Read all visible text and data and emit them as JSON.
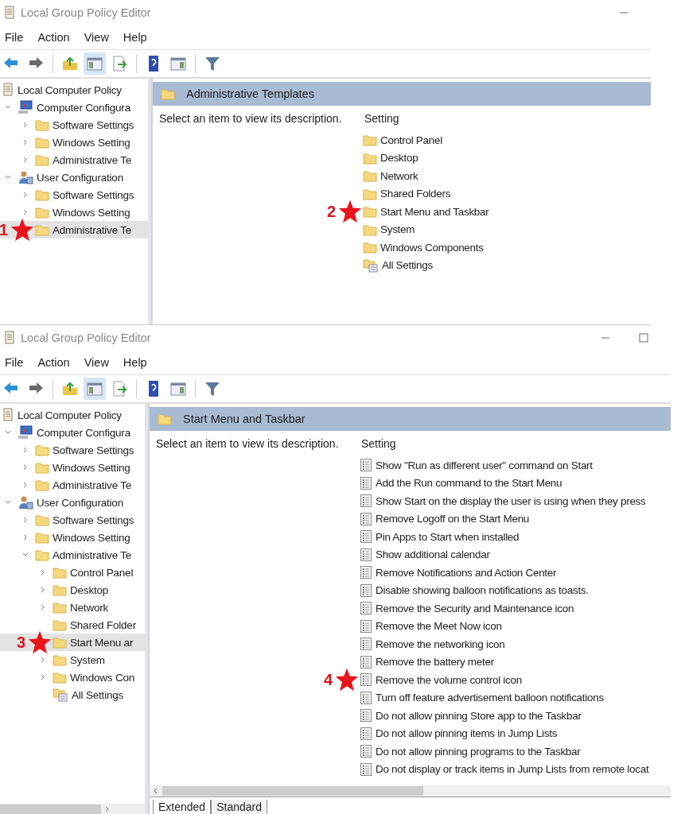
{
  "windows": [
    {
      "title": "Local Group Policy Editor",
      "menu": [
        "File",
        "Action",
        "View",
        "Help"
      ],
      "toolbar": [
        {
          "kind": "back",
          "pressed": false
        },
        {
          "kind": "forward",
          "pressed": false
        },
        {
          "kind": "separator"
        },
        {
          "kind": "up",
          "pressed": false
        },
        {
          "kind": "tree",
          "pressed": true
        },
        {
          "kind": "export",
          "pressed": false
        },
        {
          "kind": "separator"
        },
        {
          "kind": "help",
          "pressed": false
        },
        {
          "kind": "pane",
          "pressed": false
        },
        {
          "kind": "separator"
        },
        {
          "kind": "filter",
          "pressed": false
        }
      ],
      "tree": [
        {
          "label": "Local Computer Policy",
          "kind": "policy",
          "selected": false,
          "children": [
            {
              "label": "Computer Configura",
              "kind": "computer",
              "expanded": true,
              "selected": false,
              "children": [
                {
                  "label": "Software Settings",
                  "kind": "folder",
                  "expanded": false,
                  "selected": false
                },
                {
                  "label": "Windows Setting",
                  "kind": "folder",
                  "expanded": false,
                  "selected": false
                },
                {
                  "label": "Administrative Te",
                  "kind": "folder",
                  "expanded": false,
                  "selected": false
                }
              ]
            },
            {
              "label": "User Configuration",
              "kind": "user",
              "expanded": true,
              "selected": false,
              "children": [
                {
                  "label": "Software Settings",
                  "kind": "folder",
                  "expanded": false,
                  "selected": false
                },
                {
                  "label": "Windows Setting",
                  "kind": "folder",
                  "expanded": false,
                  "selected": false
                },
                {
                  "label": "Administrative Te",
                  "kind": "folder",
                  "selected": true,
                  "marker": "1"
                }
              ]
            }
          ]
        }
      ],
      "header": "Administrative Templates",
      "description": "Select an item to view its description.",
      "column": "Setting",
      "items": [
        {
          "label": "Control Panel",
          "kind": "folder"
        },
        {
          "label": "Desktop",
          "kind": "folder"
        },
        {
          "label": "Network",
          "kind": "folder"
        },
        {
          "label": "Shared Folders",
          "kind": "folder"
        },
        {
          "label": "Start Menu and Taskbar",
          "kind": "folder",
          "marker": "2"
        },
        {
          "label": "System",
          "kind": "folder"
        },
        {
          "label": "Windows Components",
          "kind": "folder"
        },
        {
          "label": "All Settings",
          "kind": "all"
        }
      ]
    },
    {
      "title": "Local Group Policy Editor",
      "menu": [
        "File",
        "Action",
        "View",
        "Help"
      ],
      "toolbar": [
        {
          "kind": "back",
          "pressed": false
        },
        {
          "kind": "forward",
          "pressed": false
        },
        {
          "kind": "separator"
        },
        {
          "kind": "up",
          "pressed": false
        },
        {
          "kind": "tree",
          "pressed": true
        },
        {
          "kind": "export",
          "pressed": false
        },
        {
          "kind": "separator"
        },
        {
          "kind": "help",
          "pressed": false
        },
        {
          "kind": "pane",
          "pressed": false
        },
        {
          "kind": "separator"
        },
        {
          "kind": "filter",
          "pressed": false
        }
      ],
      "tree": [
        {
          "label": "Local Computer Policy",
          "kind": "policy",
          "selected": false,
          "children": [
            {
              "label": "Computer Configura",
              "kind": "computer",
              "expanded": true,
              "selected": false,
              "children": [
                {
                  "label": "Software Settings",
                  "kind": "folder",
                  "expanded": false,
                  "selected": false
                },
                {
                  "label": "Windows Setting",
                  "kind": "folder",
                  "expanded": false,
                  "selected": false
                },
                {
                  "label": "Administrative Te",
                  "kind": "folder",
                  "expanded": false,
                  "selected": false
                }
              ]
            },
            {
              "label": "User Configuration",
              "kind": "user",
              "expanded": true,
              "selected": false,
              "children": [
                {
                  "label": "Software Settings",
                  "kind": "folder",
                  "expanded": false,
                  "selected": false
                },
                {
                  "label": "Windows Setting",
                  "kind": "folder",
                  "expanded": false,
                  "selected": false
                },
                {
                  "label": "Administrative Te",
                  "kind": "folder",
                  "expanded": true,
                  "selected": false,
                  "children": [
                    {
                      "label": "Control Panel",
                      "kind": "folder",
                      "expanded": false,
                      "selected": false
                    },
                    {
                      "label": "Desktop",
                      "kind": "folder",
                      "expanded": false,
                      "selected": false
                    },
                    {
                      "label": "Network",
                      "kind": "folder",
                      "expanded": false,
                      "selected": false
                    },
                    {
                      "label": "Shared Folder",
                      "kind": "folder",
                      "selected": false
                    },
                    {
                      "label": "Start Menu ar",
                      "kind": "folder",
                      "selected": true,
                      "marker": "3"
                    },
                    {
                      "label": "System",
                      "kind": "folder",
                      "expanded": false,
                      "selected": false
                    },
                    {
                      "label": "Windows Con",
                      "kind": "folder",
                      "expanded": false,
                      "selected": false
                    },
                    {
                      "label": "All Settings",
                      "kind": "all",
                      "selected": false
                    }
                  ]
                }
              ]
            }
          ]
        }
      ],
      "header": "Start Menu and Taskbar",
      "description": "Select an item to view its description.",
      "column": "Setting",
      "items": [
        {
          "label": "Show \"Run as different user\" command on Start",
          "kind": "setting"
        },
        {
          "label": "Add the Run command to the Start Menu",
          "kind": "setting"
        },
        {
          "label": "Show Start on the display the user is using when they press",
          "kind": "setting"
        },
        {
          "label": "Remove Logoff on the Start Menu",
          "kind": "setting"
        },
        {
          "label": "Pin Apps to Start when installed",
          "kind": "setting"
        },
        {
          "label": "Show additional calendar",
          "kind": "setting"
        },
        {
          "label": "Remove Notifications and Action Center",
          "kind": "setting"
        },
        {
          "label": "Disable showing balloon notifications as toasts.",
          "kind": "setting"
        },
        {
          "label": "Remove the Security and Maintenance icon",
          "kind": "setting"
        },
        {
          "label": "Remove the Meet Now icon",
          "kind": "setting"
        },
        {
          "label": "Remove the networking icon",
          "kind": "setting"
        },
        {
          "label": "Remove the battery meter",
          "kind": "setting"
        },
        {
          "label": "Remove the volume control icon",
          "kind": "setting",
          "marker": "4"
        },
        {
          "label": "Turn off feature advertisement balloon notifications",
          "kind": "setting"
        },
        {
          "label": "Do not allow pinning Store app to the Taskbar",
          "kind": "setting"
        },
        {
          "label": "Do not allow pinning items in Jump Lists",
          "kind": "setting"
        },
        {
          "label": "Do not allow pinning programs to the Taskbar",
          "kind": "setting"
        },
        {
          "label": "Do not display or track items in Jump Lists from remote locat",
          "kind": "setting"
        }
      ],
      "tabs": [
        {
          "label": "Extended",
          "selected": true
        },
        {
          "label": "Standard",
          "selected": false
        }
      ]
    }
  ]
}
